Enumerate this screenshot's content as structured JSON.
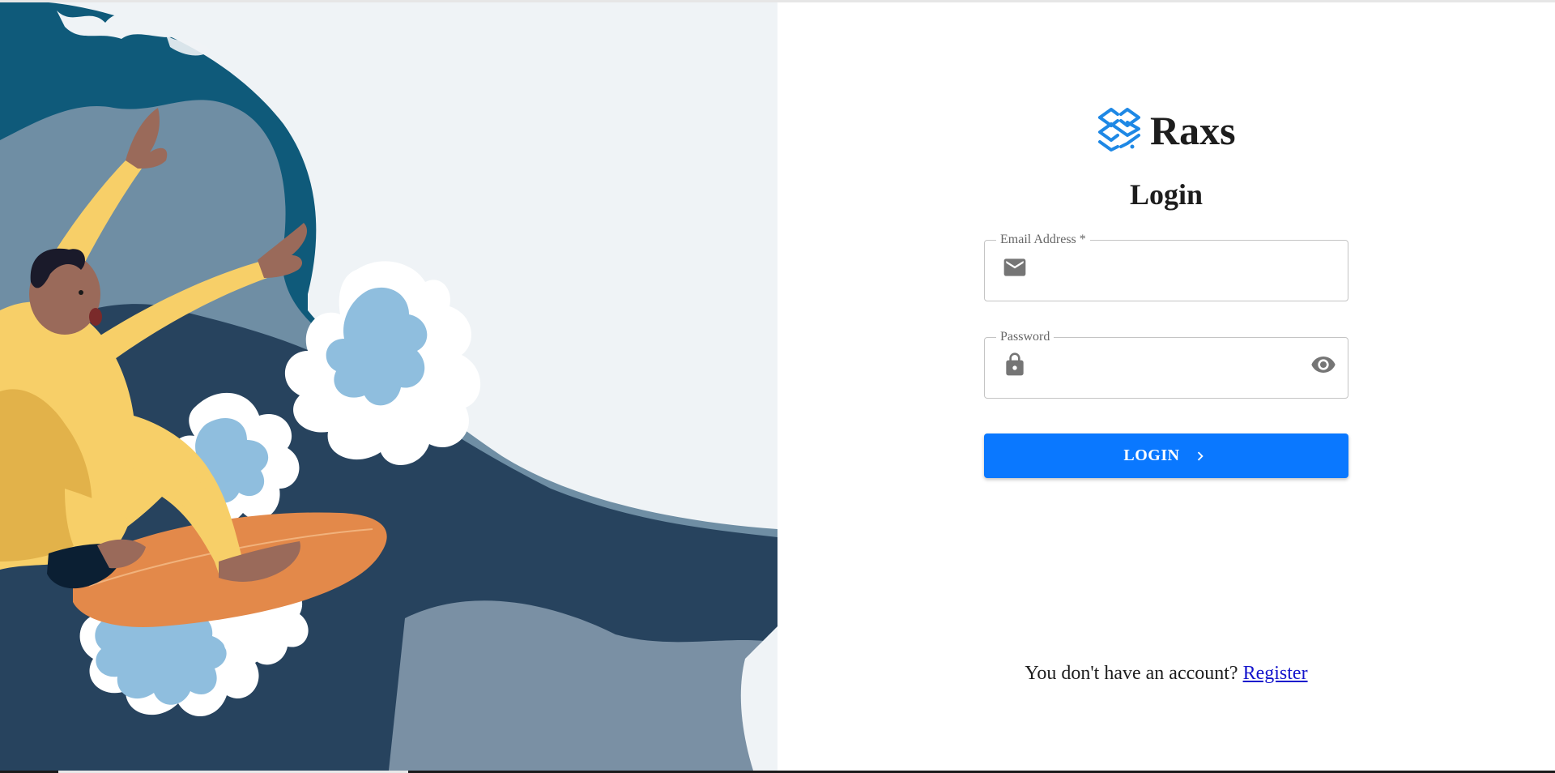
{
  "brand": {
    "name": "Raxs",
    "logo_icon": "stacked-layers-logo-icon",
    "logo_color": "#1e88e5"
  },
  "login_form": {
    "title": "Login",
    "email": {
      "label": "Email Address *",
      "value": "",
      "icon": "envelope-icon"
    },
    "password": {
      "label": "Password",
      "value": "",
      "icon": "lock-icon",
      "toggle_icon": "eye-icon"
    },
    "submit": {
      "label": "LOGIN",
      "icon": "chevron-right-icon",
      "color": "#0a78ff"
    }
  },
  "footer": {
    "prompt": "You don't have an account? ",
    "link": "Register",
    "link_color": "#1414cc"
  },
  "illustration": {
    "subject": "surfer-illustration"
  },
  "colors": {
    "background": "#ffffff",
    "illustration_sky": "#eff3f6",
    "wave_dark": "#0f5a7a",
    "wave_mid": "#6f8ea4",
    "wave_navy": "#27435e",
    "suit_yellow": "#f7cf68",
    "board_orange": "#e3894a",
    "foam_blue": "#8fbede"
  }
}
